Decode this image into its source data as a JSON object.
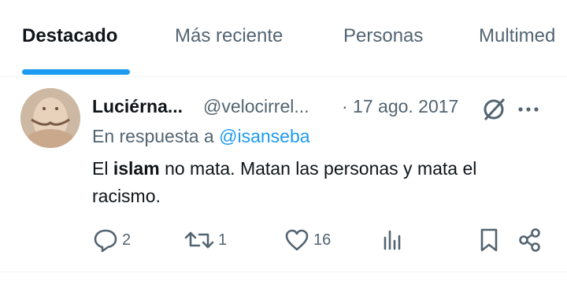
{
  "tabs": [
    {
      "label": "Destacado",
      "active": true
    },
    {
      "label": "Más reciente",
      "active": false
    },
    {
      "label": "Personas",
      "active": false
    },
    {
      "label": "Multimed",
      "active": false
    }
  ],
  "tweet": {
    "name": "Luciérna...",
    "handle": "@velocirrel...",
    "date": "· 17 ago. 2017",
    "reply_prefix": "En respuesta a",
    "reply_mention": "@isanseba",
    "text_prefix": "El",
    "text_bold": "islam",
    "text_line1_rest": "no mata. Matan las personas y mata el",
    "text_line2": "racismo.",
    "replies": "2",
    "retweets": "1",
    "likes": "16"
  },
  "icons": [
    "grok-icon",
    "more-icon",
    "reply-icon",
    "retweet-icon",
    "like-icon",
    "views-icon",
    "bookmark-icon",
    "share-icon"
  ],
  "colors": {
    "accent": "#1d9bf0",
    "secondary_text": "#536471",
    "text": "#0f1419"
  }
}
